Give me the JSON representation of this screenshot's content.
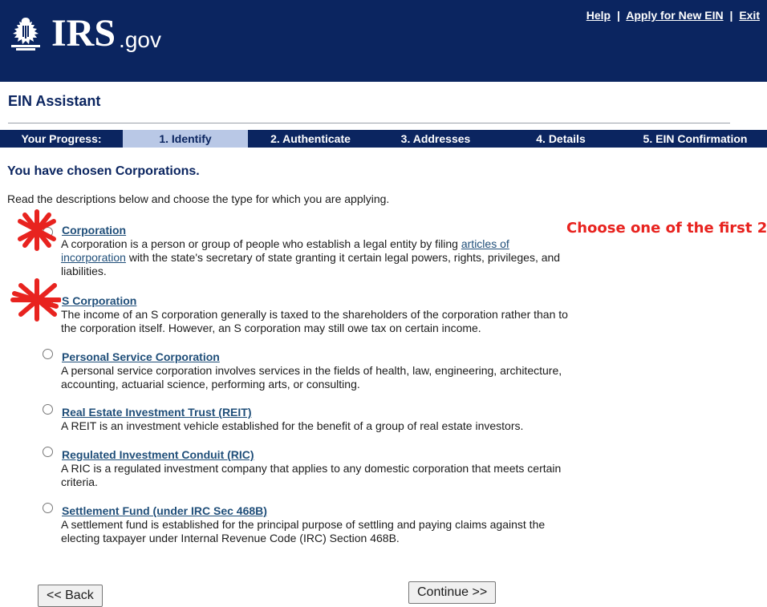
{
  "header": {
    "logo_text": "IRS",
    "logo_suffix": ".gov",
    "links": [
      "Help",
      "Apply for New EIN",
      "Exit"
    ],
    "separator": "|"
  },
  "app_title": "EIN Assistant",
  "progress": {
    "label": "Your Progress:",
    "steps": [
      "1. Identify",
      "2. Authenticate",
      "3. Addresses",
      "4. Details",
      "5. EIN Confirmation"
    ],
    "active_step": "1. Identify"
  },
  "chosen_heading": "You have chosen Corporations.",
  "instructions": "Read the descriptions below and choose the type for which you are applying.",
  "annotation_note": "Choose one of the first 2",
  "options": [
    {
      "title": "Corporation",
      "desc_before_link": "A corporation is a person or group of people who establish a legal entity by filing ",
      "link_text": "articles of incorporation",
      "desc_after_link": " with the state's secretary of state granting it certain legal powers, rights, privileges, and liabilities."
    },
    {
      "title": "S Corporation",
      "desc": "The income of an S corporation generally is taxed to the shareholders of the corporation rather than to the corporation itself. However, an S corporation may still owe tax on certain income."
    },
    {
      "title": "Personal Service Corporation",
      "desc": "A personal service corporation involves services in the fields of health, law, engineering, architecture, accounting, actuarial science, performing arts, or consulting."
    },
    {
      "title": "Real Estate Investment Trust (REIT)",
      "desc": "A REIT is an investment vehicle established for the benefit of a group of real estate investors."
    },
    {
      "title": "Regulated Investment Conduit (RIC)",
      "desc": "A RIC is a regulated investment company that applies to any domestic corporation that meets certain criteria."
    },
    {
      "title": "Settlement Fund (under IRC Sec 468B)",
      "desc": "A settlement fund is established for the principal purpose of settling and paying claims against the electing taxpayer under Internal Revenue Code (IRC) Section 468B."
    }
  ],
  "buttons": {
    "back": "<< Back",
    "continue": "Continue >>"
  },
  "colors": {
    "header_bg": "#0b2560",
    "active_step_bg": "#b9c8e6",
    "link": "#1f4e79",
    "annotation": "#e8231f"
  }
}
